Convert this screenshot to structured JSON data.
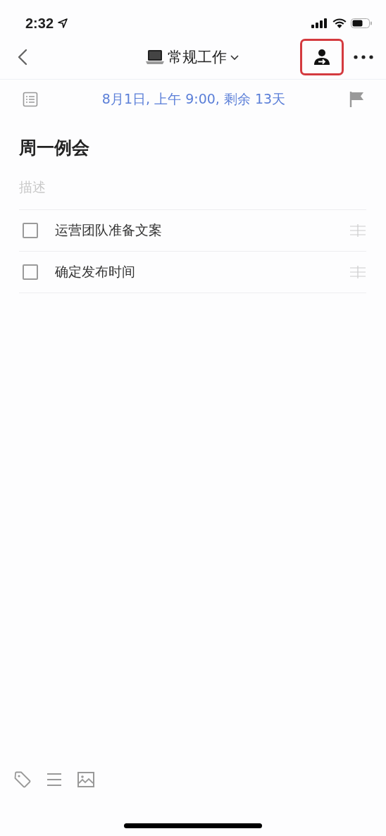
{
  "status_bar": {
    "time": "2:32"
  },
  "nav": {
    "title": "常规工作",
    "assign_highlighted": true
  },
  "due": "8月1日, 上午 9:00, 剩余 13天",
  "task": {
    "title": "周一例会",
    "description_placeholder": "描述"
  },
  "subtasks": [
    {
      "text": "运营团队准备文案",
      "checked": false
    },
    {
      "text": "确定发布时间",
      "checked": false
    }
  ]
}
